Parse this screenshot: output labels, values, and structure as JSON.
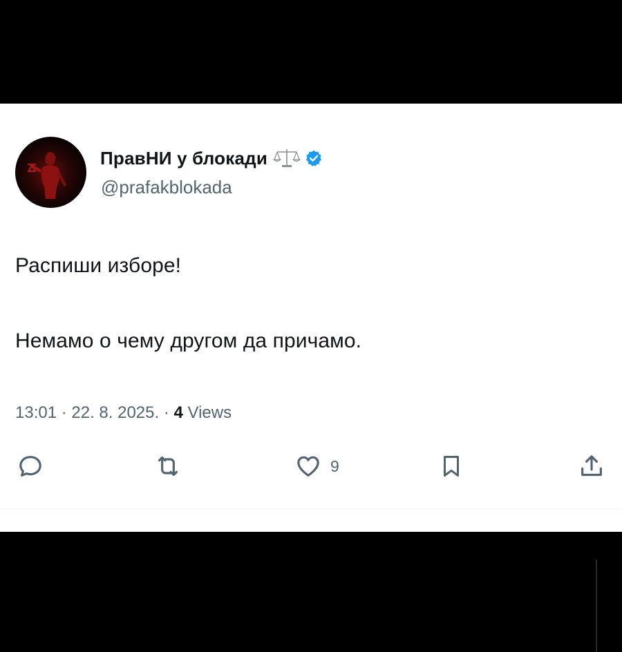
{
  "tweet": {
    "display_name": "ПравНИ у блокади",
    "handle": "@prafakblokada",
    "text_line_1": "Распиши изборе!",
    "text_line_2": "Немамо о чему другом да причамо.",
    "timestamp": "13:01 · 22. 8. 2025. · ",
    "view_count": "4",
    "views_label": " Views",
    "icons": {
      "name_emoji": "balance-scale-icon",
      "verified": "verified-badge-icon"
    }
  },
  "actions": {
    "reply_icon": "reply-icon",
    "retweet_icon": "retweet-icon",
    "like_icon": "heart-icon",
    "like_count": "9",
    "bookmark_icon": "bookmark-icon",
    "share_icon": "share-icon"
  },
  "colors": {
    "background": "#000000",
    "card": "#ffffff",
    "primary_text": "#0f1419",
    "secondary_text": "#536471",
    "verified": "#1d9bf0"
  }
}
